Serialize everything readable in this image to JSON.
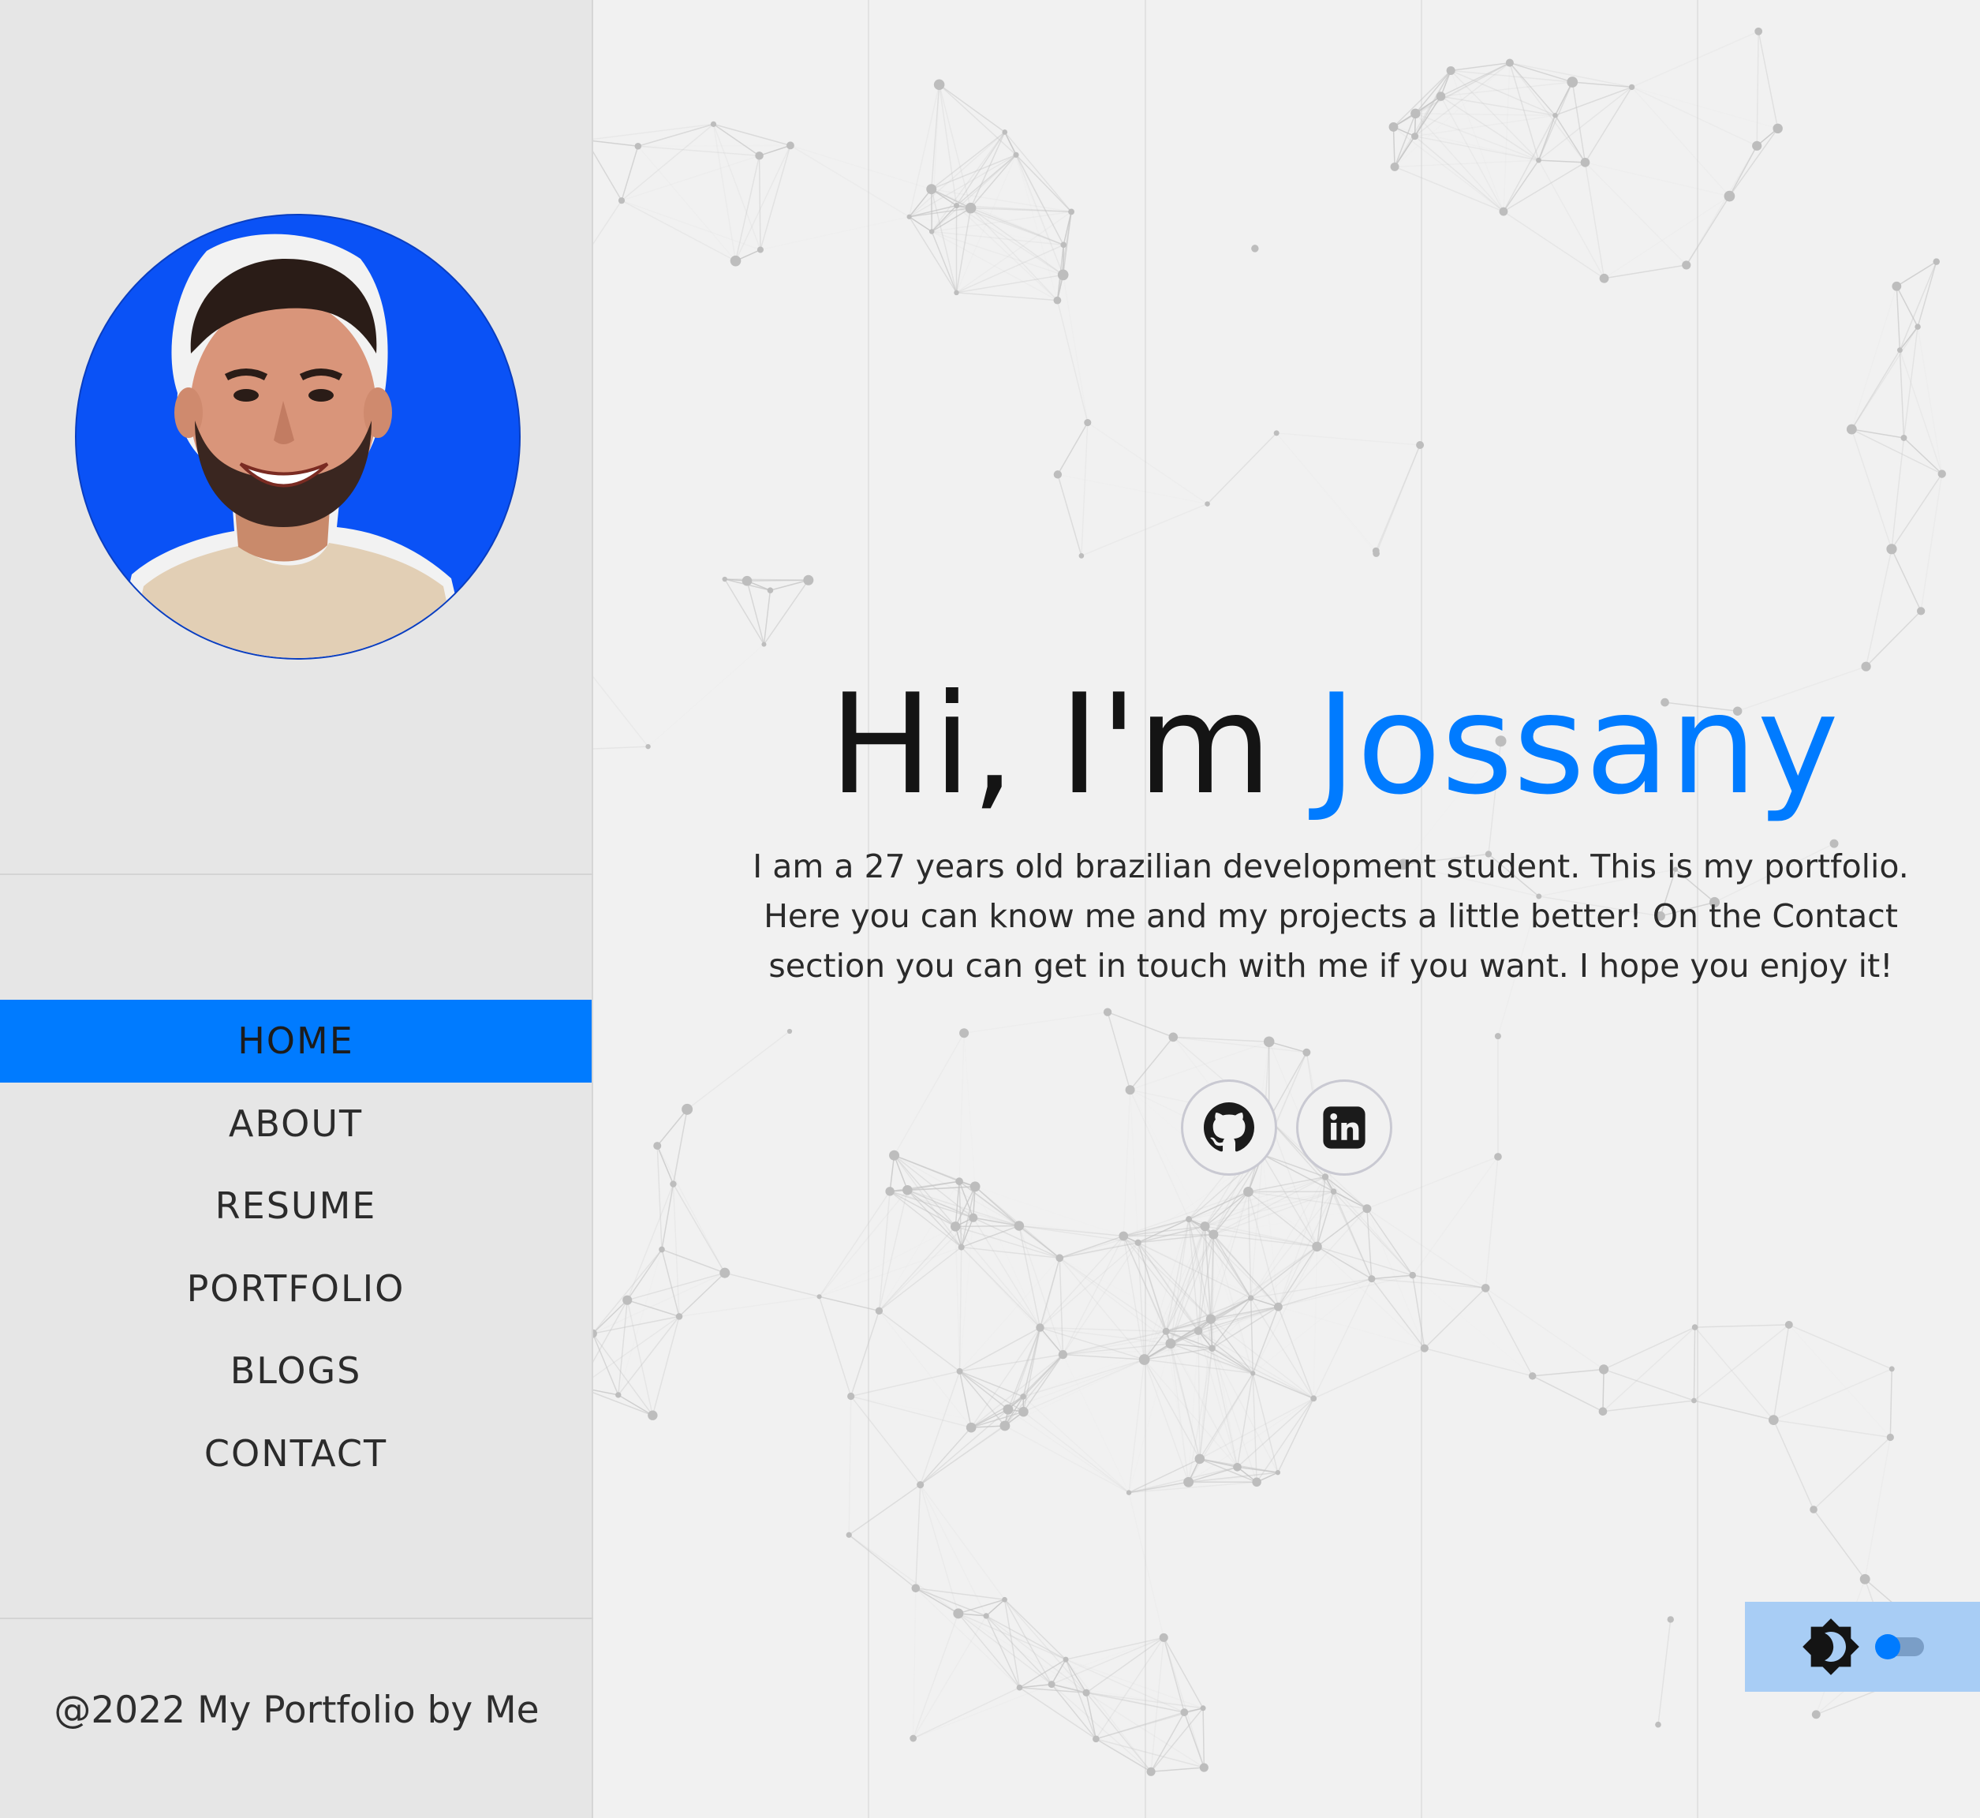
{
  "sidebar": {
    "avatar_alt": "Profile photo",
    "nav": [
      {
        "label": "HOME",
        "active": true
      },
      {
        "label": "ABOUT",
        "active": false
      },
      {
        "label": "RESUME",
        "active": false
      },
      {
        "label": "PORTFOLIO",
        "active": false
      },
      {
        "label": "BLOGS",
        "active": false
      },
      {
        "label": "CONTACT",
        "active": false
      }
    ],
    "footer": "@2022 My Portfolio by Me"
  },
  "hero": {
    "greeting": "Hi, I'm ",
    "name": "Jossany",
    "description": "I am a 27 years old brazilian development student. This is my portfolio. Here you can know me and my projects a little better! On the Contact section you can get in touch with me if you want. I hope you enjoy it!"
  },
  "socials": [
    {
      "icon": "github-icon"
    },
    {
      "icon": "linkedin-icon"
    }
  ],
  "theme": {
    "icon": "brightness-icon",
    "dark_mode": false
  },
  "colors": {
    "accent": "#007bff",
    "sidebar_bg": "#e6e6e6",
    "page_bg": "#f1f1f1",
    "avatar_bg": "#0a52f6",
    "toggle_panel": "#a8cdf5"
  }
}
